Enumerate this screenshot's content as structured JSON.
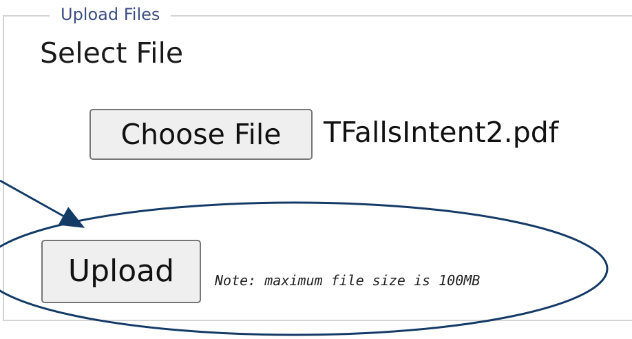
{
  "upload_panel": {
    "legend": "Upload Files",
    "section_title": "Select File",
    "choose_file_label": "Choose File",
    "selected_file_name": "TFallsIntent2.pdf",
    "upload_label": "Upload",
    "note": "Note: maximum file size is 100MB"
  },
  "annotation": {
    "arrow_icon": "arrow-right-down-icon",
    "highlight_shape": "ellipse",
    "color": "#143a66"
  }
}
